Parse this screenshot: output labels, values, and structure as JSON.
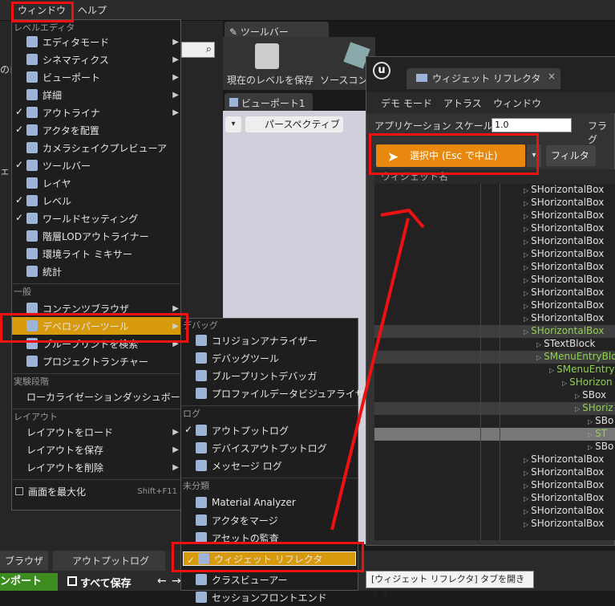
{
  "menubar": {
    "window": "ウィンドウ",
    "help": "ヘルプ"
  },
  "bg": {
    "level_editor": "レベルエディタ",
    "toolbar_tab": "ツールバー",
    "save_level": "現在のレベルを保存",
    "source": "ソースコン",
    "viewport_tab": "ビューポート1",
    "perspective": "パースペクティブ",
    "left_fragment_1": "のロ",
    "left_fragment_2": "ェ",
    "bottom_tab_browser": "ブラウザ",
    "bottom_tab_output": "アウトプットログ",
    "bottom_import": "ンポート",
    "bottom_saveall": "すべて保存",
    "tooltip": "[ウィジェット リフレクタ] タブを開きます。"
  },
  "window_menu": {
    "items": [
      {
        "label": "エディタモード",
        "check": false,
        "arrow": true,
        "icon": "editor-mode-icon"
      },
      {
        "label": "シネマティクス",
        "check": false,
        "arrow": true,
        "icon": "cinematics-icon"
      },
      {
        "label": "ビューポート",
        "check": false,
        "arrow": true,
        "icon": "viewport-icon"
      },
      {
        "label": "詳細",
        "check": false,
        "arrow": true,
        "icon": "details-icon"
      },
      {
        "label": "アウトライナ",
        "check": true,
        "arrow": true,
        "icon": "outliner-icon"
      },
      {
        "label": "アクタを配置",
        "check": true,
        "arrow": false,
        "icon": "place-actor-icon"
      },
      {
        "label": "カメラシェイクプレビューア",
        "check": false,
        "arrow": false,
        "icon": "camera-shake-icon"
      },
      {
        "label": "ツールバー",
        "check": true,
        "arrow": false,
        "icon": "toolbar-icon"
      },
      {
        "label": "レイヤ",
        "check": false,
        "arrow": false,
        "icon": "layers-icon"
      },
      {
        "label": "レベル",
        "check": true,
        "arrow": false,
        "icon": "levels-icon"
      },
      {
        "label": "ワールドセッティング",
        "check": true,
        "arrow": false,
        "icon": "world-settings-icon"
      },
      {
        "label": "階層LODアウトライナー",
        "check": false,
        "arrow": false,
        "icon": "hlod-icon"
      },
      {
        "label": "環境ライト ミキサー",
        "check": false,
        "arrow": false,
        "icon": "env-light-icon"
      },
      {
        "label": "統計",
        "check": false,
        "arrow": false,
        "icon": "stats-icon"
      }
    ],
    "general_section": "一般",
    "general": [
      {
        "label": "コンテンツブラウザ",
        "arrow": true,
        "icon": "content-browser-icon"
      },
      {
        "label": "デベロッパーツール",
        "arrow": true,
        "icon": "developer-tools-icon"
      },
      {
        "label": "ブループリントを検索",
        "arrow": true,
        "icon": "find-blueprint-icon"
      },
      {
        "label": "プロジェクトランチャー",
        "arrow": false,
        "icon": "project-launcher-icon"
      }
    ],
    "experimental_section": "実験段階",
    "experimental": [
      {
        "label": "ローカライゼーションダッシュボード"
      }
    ],
    "layout_section": "レイアウト",
    "layout": [
      {
        "label": "レイアウトをロード",
        "arrow": true
      },
      {
        "label": "レイアウトを保存",
        "arrow": true
      },
      {
        "label": "レイアウトを削除",
        "arrow": true
      }
    ],
    "fullscreen": "画面を最大化",
    "fullscreen_shortcut": "Shift+F11"
  },
  "dev_menu": {
    "debug_section": "デバッグ",
    "debug": [
      {
        "label": "コリジョンアナライザー",
        "icon": "collision-icon"
      },
      {
        "label": "デバッグツール",
        "icon": "debug-tools-icon"
      },
      {
        "label": "ブループリントデバッガ",
        "icon": "bp-debugger-icon"
      },
      {
        "label": "プロファイルデータビジュアライザ",
        "icon": "profile-icon"
      }
    ],
    "log_section": "ログ",
    "log": [
      {
        "label": "アウトプットログ",
        "check": true,
        "icon": "output-log-icon"
      },
      {
        "label": "デバイスアウトプットログ",
        "check": false,
        "icon": "device-log-icon"
      },
      {
        "label": "メッセージ ログ",
        "check": false,
        "icon": "message-log-icon"
      }
    ],
    "misc_section": "未分類",
    "misc": [
      {
        "label": "Material Analyzer",
        "icon": "material-icon"
      },
      {
        "label": "アクタをマージ",
        "icon": "merge-icon"
      },
      {
        "label": "アセットの監査",
        "icon": "audit-icon"
      },
      {
        "label": "ウィジェット リフレクタ",
        "icon": "widget-reflector-icon",
        "check": true
      },
      {
        "label": "クラスビューアー",
        "icon": "class-viewer-icon"
      },
      {
        "label": "セッションフロントエンド",
        "icon": "session-icon"
      }
    ]
  },
  "reflector": {
    "logo": "u",
    "tab": "ウィジェット リフレクタ",
    "menu": [
      "デモ モード",
      "アトラス",
      "ウィンドウ"
    ],
    "scale_label": "アプリケーション スケール:",
    "scale_value": "1.0",
    "flags_label": "フラグ",
    "pick_button": "選択中 (Esc で中止)",
    "filter_button": "フィルタ",
    "column_header": "ウィジェット名",
    "tree": [
      {
        "label": "SHorizontalBox",
        "level": 0,
        "color": "#e0e0e0"
      },
      {
        "label": "SHorizontalBox",
        "level": 0,
        "color": "#e0e0e0"
      },
      {
        "label": "SHorizontalBox",
        "level": 0,
        "color": "#e0e0e0"
      },
      {
        "label": "SHorizontalBox",
        "level": 0,
        "color": "#e0e0e0"
      },
      {
        "label": "SHorizontalBox",
        "level": 0,
        "color": "#e0e0e0"
      },
      {
        "label": "SHorizontalBox",
        "level": 0,
        "color": "#e0e0e0"
      },
      {
        "label": "SHorizontalBox",
        "level": 0,
        "color": "#e0e0e0"
      },
      {
        "label": "SHorizontalBox",
        "level": 0,
        "color": "#e0e0e0"
      },
      {
        "label": "SHorizontalBox",
        "level": 0,
        "color": "#e0e0e0"
      },
      {
        "label": "SHorizontalBox",
        "level": 0,
        "color": "#e0e0e0"
      },
      {
        "label": "SHorizontalBox",
        "level": 0,
        "color": "#e0e0e0"
      },
      {
        "label": "SHorizontalBox",
        "level": 0,
        "color": "#8fd14f"
      },
      {
        "label": "STextBlock",
        "level": 1,
        "color": "#e0e0e0"
      },
      {
        "label": "SMenuEntryBlo",
        "level": 1,
        "color": "#8fd14f"
      },
      {
        "label": "SMenuEntry",
        "level": 2,
        "color": "#8fd14f"
      },
      {
        "label": "SHorizon",
        "level": 3,
        "color": "#8fd14f"
      },
      {
        "label": "SBox",
        "level": 4,
        "color": "#e0e0e0"
      },
      {
        "label": "SHoriz",
        "level": 4,
        "color": "#8fd14f"
      },
      {
        "label": "SBo",
        "level": 5,
        "color": "#e0e0e0"
      },
      {
        "label": "ST",
        "level": 5,
        "color": "#8fd14f"
      },
      {
        "label": "SBo",
        "level": 5,
        "color": "#e0e0e0"
      },
      {
        "label": "SHorizontalBox",
        "level": 0,
        "color": "#e0e0e0"
      },
      {
        "label": "SHorizontalBox",
        "level": 0,
        "color": "#e0e0e0"
      },
      {
        "label": "SHorizontalBox",
        "level": 0,
        "color": "#e0e0e0"
      },
      {
        "label": "SHorizontalBox",
        "level": 0,
        "color": "#e0e0e0"
      },
      {
        "label": "SHorizontalBox",
        "level": 0,
        "color": "#e0e0e0"
      },
      {
        "label": "SHorizontalBox",
        "level": 0,
        "color": "#e0e0e0"
      }
    ]
  },
  "colors": {
    "accent": "#e8880e",
    "highlight": "#d69a0c",
    "annotation": "#e11111"
  }
}
